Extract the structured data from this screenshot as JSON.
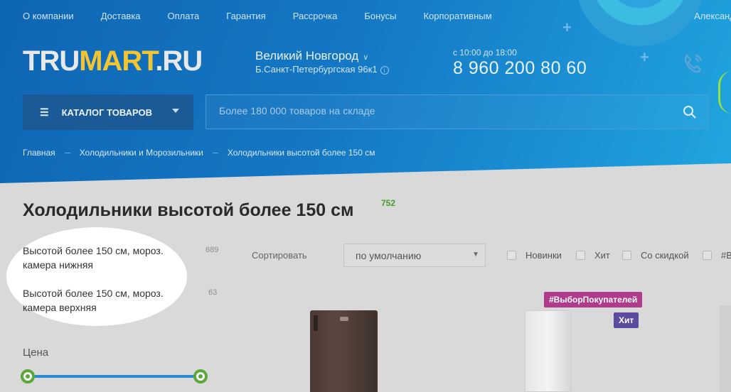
{
  "topnav": [
    "О компании",
    "Доставка",
    "Оплата",
    "Гарантия",
    "Рассрочка",
    "Бонусы",
    "Корпоративным"
  ],
  "user_name": "Александ",
  "logo": {
    "part1": "TRU",
    "part2": "MART",
    "part3": ".RU"
  },
  "location": {
    "city": "Великий Новгород",
    "address": "Б.Санкт-Петербургская 96к1"
  },
  "contact": {
    "hours": "с 10:00 до 18:00",
    "phone": "8 960 200 80 60"
  },
  "catalog_button": "КАТАЛОГ ТОВАРОВ",
  "search": {
    "placeholder": "Более 180 000 товаров на складе"
  },
  "breadcrumb": [
    "Главная",
    "Холодильники и Морозильники",
    "Холодильники высотой более 150 см"
  ],
  "page": {
    "title": "Холодильники высотой более 150 см",
    "count": "752"
  },
  "filters": [
    {
      "label": "Высотой более 150 см, мороз. камера нижняя",
      "count": "689"
    },
    {
      "label": "Высотой более 150 см, мороз. камера верхняя",
      "count": "63"
    }
  ],
  "price_filter": {
    "label": "Цена"
  },
  "sort": {
    "label": "Сортировать",
    "selected": "по умолчанию"
  },
  "checkboxes": [
    "Новинки",
    "Хит",
    "Со скидкой",
    "#В"
  ],
  "badges": {
    "choice": "#ВыборПокупателей",
    "hit": "Хит"
  },
  "colors": {
    "header": "#1477c4",
    "accent_yellow": "#f3c532",
    "count_green": "#4a9a2e",
    "badge_pink": "#b03a8c",
    "badge_purple": "#5b4ba0"
  }
}
